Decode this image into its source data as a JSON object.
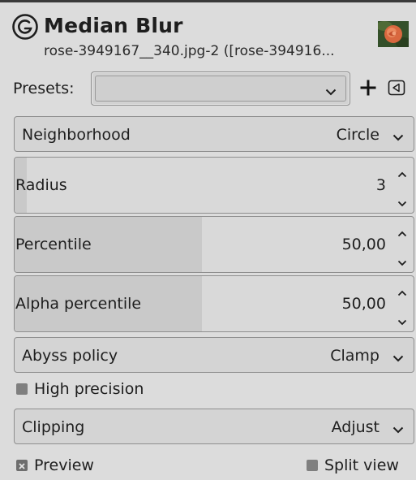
{
  "header": {
    "title": "Median Blur",
    "subtitle": "rose-3949167__340.jpg-2 ([rose-394916..."
  },
  "presets": {
    "label": "Presets:",
    "value": ""
  },
  "neighborhood": {
    "label": "Neighborhood",
    "value": "Circle"
  },
  "radius": {
    "label": "Radius",
    "value": "3",
    "fill_fraction": 0.03
  },
  "percentile": {
    "label": "Percentile",
    "value": "50,00",
    "fill_fraction": 0.47
  },
  "alpha_percentile": {
    "label": "Alpha percentile",
    "value": "50,00",
    "fill_fraction": 0.47
  },
  "abyss_policy": {
    "label": "Abyss policy",
    "value": "Clamp"
  },
  "high_precision": {
    "label": "High precision",
    "checked": false
  },
  "clipping": {
    "label": "Clipping",
    "value": "Adjust"
  },
  "preview": {
    "label": "Preview",
    "checked": true
  },
  "split_view": {
    "label": "Split view",
    "checked": false
  },
  "icons": {
    "header": "gegl-icon",
    "thumbnail": "image-thumbnail",
    "add": "plus-icon",
    "menu": "menu-triangle-icon",
    "dropdown": "chevron-down-icon",
    "spin_up": "chevron-up-icon",
    "spin_down": "chevron-down-icon"
  }
}
